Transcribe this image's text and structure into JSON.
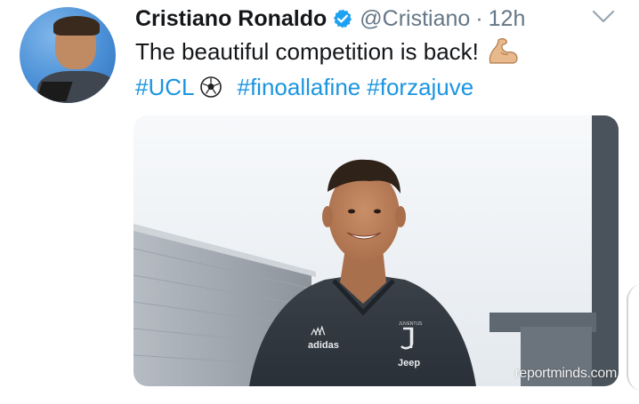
{
  "tweet": {
    "display_name": "Cristiano Ronaldo",
    "handle": "@Cristiano",
    "separator": "·",
    "time": "12h",
    "text": "The beautiful competition is back!",
    "hashtags": [
      "#UCL",
      "#finoallafine",
      "#forzajuve"
    ],
    "icons": {
      "verified": "verified-badge-icon",
      "menu": "chevron-down-icon",
      "emoji_1": "flexed-biceps-icon",
      "emoji_2": "soccer-ball-icon"
    },
    "colors": {
      "link": "#1b95e0",
      "secondary_text": "#657786",
      "verified": "#1da1f2"
    },
    "media": {
      "watermark": "reportminds.com",
      "shirt_brand": "adidas",
      "shirt_sponsor": "Jeep",
      "shirt_text": "JUVENTUS"
    }
  }
}
